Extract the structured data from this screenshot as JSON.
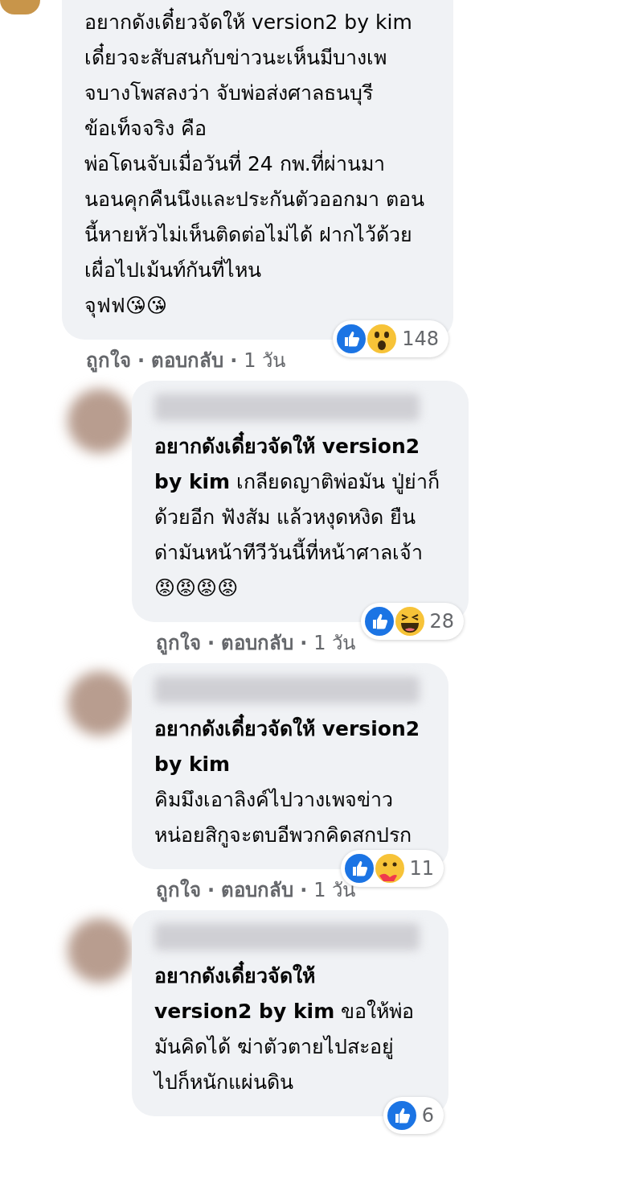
{
  "separator": "·",
  "comments": [
    {
      "kind": "cropped",
      "text": "อยากดังเดี๋ยวจัดให้ version2 by kim\nเดี๋ยวจะสับสนกับข่าวนะเห็นมีบางเพ\nจบางโพสลงว่า จับพ่อส่งศาลธนบุรี\nข้อเท็จจริง คือ\nพ่อโดนจับเมื่อวันที่ 24 กพ.ที่ผ่านมา\nนอนคุกคืนนึงและประกันตัวออกมา ตอน\nนี้หายหัวไม่เห็นติดต่อไม่ได้ ฝากไว้ด้วย\nเผื่อไปเม้นท์กันที่ไหน\nจุฟฟ😘😘",
      "reactions": [
        {
          "kind": "like"
        },
        {
          "kind": "wow"
        }
      ],
      "count": "148",
      "actions": [
        "ถูกใจ",
        "ตอบกลับ",
        "1 วัน"
      ]
    },
    {
      "kind": "full",
      "text": "**อยากดังเดี๋ยวจัดให้ version2**\n**by kim** เกลียดญาติพ่อมัน ปู่ย่าก็\nด้วยอีก ฟังสัม แล้วหงุดหงิด ยืน\nด่ามันหน้าทีวีวันนี้ที่หน้าศาลเจ้า\n😡😡😡😡",
      "reactions": [
        {
          "kind": "like"
        },
        {
          "kind": "haha"
        }
      ],
      "count": "28",
      "actions": [
        "ถูกใจ",
        "ตอบกลับ",
        "1 วัน"
      ]
    },
    {
      "kind": "full",
      "text": "**อยากดังเดี๋ยวจัดให้ version2**\n**by kim**\nคิมมึงเอาลิงค์ไปวางเพจข่าว\nหน่อยสิกูจะตบอีพวกคิดสกปรก",
      "reactions": [
        {
          "kind": "like"
        },
        {
          "kind": "care"
        }
      ],
      "count": "11",
      "actions": [
        "ถูกใจ",
        "ตอบกลับ",
        "1 วัน"
      ]
    },
    {
      "kind": "full",
      "text": "**อยากดังเดี๋ยวจัดให้**\n**version2 by kim** ขอให้พ่อ\nมันคิดได้ ฆ่าตัวตายไปสะอยู่\nไปก็หนักแผ่นดิน",
      "reactions": [
        {
          "kind": "like"
        }
      ],
      "count": "6"
    }
  ]
}
